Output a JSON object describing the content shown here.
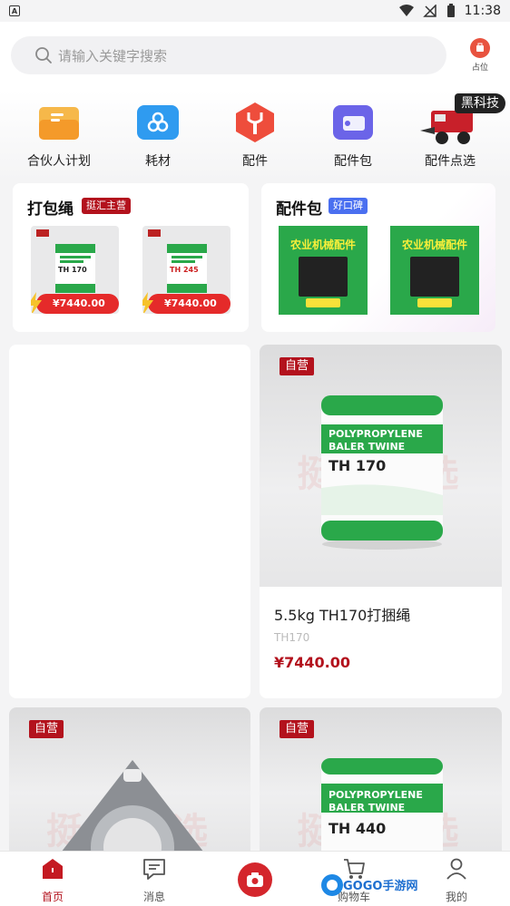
{
  "status_bar": {
    "time": "11:38"
  },
  "header": {
    "search_placeholder": "请输入关键字搜索",
    "occupy_label": "占位"
  },
  "categories": [
    {
      "label": "合伙人计划",
      "icon": "partner-icon"
    },
    {
      "label": "耗材",
      "icon": "consumables-icon"
    },
    {
      "label": "配件",
      "icon": "wrench-icon"
    },
    {
      "label": "配件包",
      "icon": "wallet-icon"
    },
    {
      "label": "配件点选",
      "icon": "baler-machine-icon"
    }
  ],
  "black_tech_tag": "黑科技",
  "feature_cards": {
    "twine": {
      "title": "打包绳",
      "badge": "挺汇主营",
      "items": [
        {
          "model": "TH 170",
          "price": "¥7440.00"
        },
        {
          "model": "TH 245",
          "price": "¥7440.00"
        }
      ]
    },
    "parts_pack": {
      "title": "配件包",
      "badge": "好口碑",
      "items": [
        {
          "banner": "农业机械配件"
        },
        {
          "banner": "农业机械配件"
        }
      ]
    }
  },
  "products": [
    {
      "tag": "自营",
      "name": "5.5kg TH170打捆绳",
      "code": "TH170",
      "price": "¥7440.00",
      "spool_line1": "POLYPROPYLENE",
      "spool_line2": "BALER TWINE",
      "spool_model": "TH 170",
      "watermark": "挺汇优选"
    },
    {
      "tag": "自营",
      "watermark": "挺汇优选"
    },
    {
      "tag": "自营",
      "spool_line1": "POLYPROPYLENE",
      "spool_line2": "BALER TWINE",
      "spool_model": "TH 440",
      "watermark": "挺汇优选"
    }
  ],
  "bottom_nav": [
    {
      "label": "首页",
      "active": true
    },
    {
      "label": "消息"
    },
    {
      "label": "购物车"
    },
    {
      "label": "我的"
    }
  ],
  "overlay_logo": "GOGO手游网",
  "colors": {
    "brand_red": "#b3121d",
    "price_red": "#e52a2a",
    "search_bg": "#f1f1f3"
  }
}
